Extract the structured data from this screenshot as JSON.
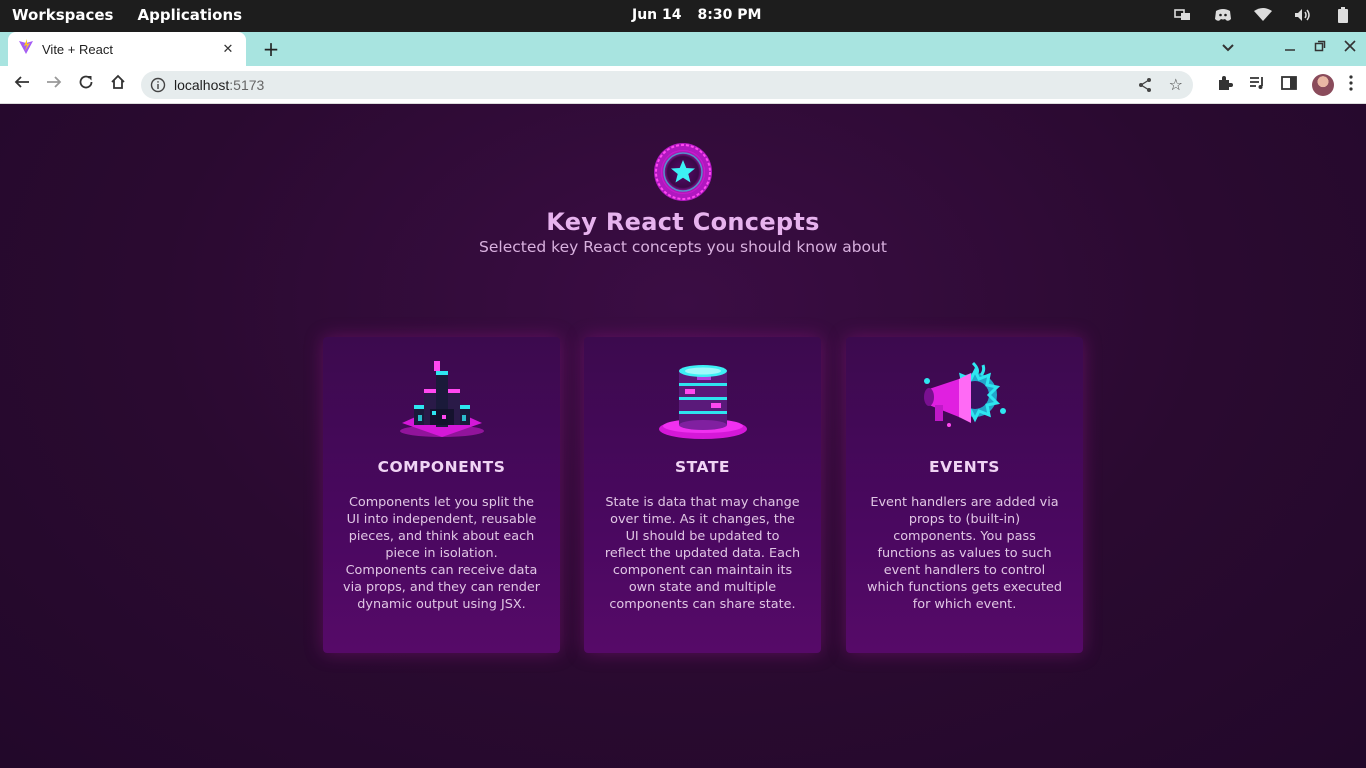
{
  "os": {
    "workspaces": "Workspaces",
    "applications": "Applications",
    "date": "Jun 14",
    "time": "8:30 PM"
  },
  "browser": {
    "tab_title": "Vite + React",
    "url_host": "localhost",
    "url_port": ":5173"
  },
  "app": {
    "title": "Key React Concepts",
    "subtitle": "Selected key React concepts you should know about",
    "cards": [
      {
        "title": "COMPONENTS",
        "description": "Components let you split the UI into independent, reusable pieces, and think about each piece in isolation. Components can receive data via props, and they can render dynamic output using JSX."
      },
      {
        "title": "STATE",
        "description": "State is data that may change over time. As it changes, the UI should be updated to reflect the updated data. Each component can maintain its own state and multiple components can share state."
      },
      {
        "title": "EVENTS",
        "description": "Event handlers are added via props to (built-in) components. You pass functions as values to such event handlers to control which functions gets executed for which event."
      }
    ]
  },
  "colors": {
    "page_bg": "#2a0a30",
    "card_bg": "#4a0860",
    "title": "#e7b3ee",
    "accent_cyan": "#2ee6f0",
    "accent_magenta": "#e020e0",
    "tab_strip": "#a8e4e0"
  },
  "icons": [
    "vite-icon",
    "close-icon",
    "plus-icon",
    "chevron-down-icon",
    "minimize-icon",
    "maximize-icon",
    "back-icon",
    "forward-icon",
    "reload-icon",
    "home-icon",
    "info-icon",
    "share-icon",
    "star-icon",
    "extensions-icon",
    "media-icon",
    "sidepanel-icon",
    "menu-icon",
    "star-badge-icon",
    "network-icon",
    "discord-icon",
    "wifi-icon",
    "volume-icon",
    "battery-icon"
  ]
}
